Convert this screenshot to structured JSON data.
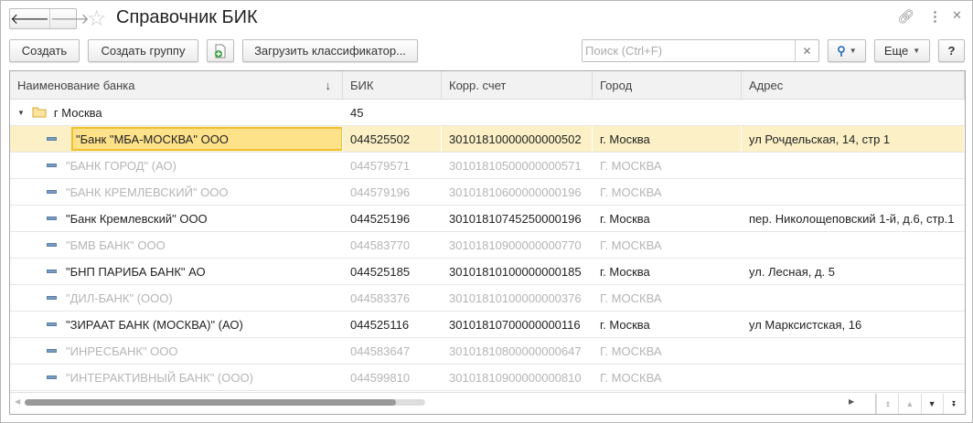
{
  "window": {
    "title": "Справочник БИК"
  },
  "toolbar": {
    "create": "Создать",
    "create_group": "Создать группу",
    "load": "Загрузить классификатор...",
    "search_placeholder": "Поиск (Ctrl+F)",
    "more": "Еще",
    "help": "?"
  },
  "columns": [
    "Наименование банка",
    "БИК",
    "Корр. счет",
    "Город",
    "Адрес"
  ],
  "sort_indicator": "↓",
  "group": {
    "name": "г Москва",
    "count": "45"
  },
  "rows": [
    {
      "name": "\"Банк \"МБА-МОСКВА\" ООО",
      "bik": "044525502",
      "corr": "30101810000000000502",
      "city": "г. Москва",
      "address": "ул Рочдельская, 14, стр 1",
      "state": "selected"
    },
    {
      "name": "\"БАНК ГОРОД\" (АО)",
      "bik": "044579571",
      "corr": "30101810500000000571",
      "city": "Г. МОСКВА",
      "address": "",
      "state": "inactive"
    },
    {
      "name": "\"БАНК КРЕМЛЕВСКИЙ\" ООО",
      "bik": "044579196",
      "corr": "30101810600000000196",
      "city": "Г. МОСКВА",
      "address": "",
      "state": "inactive"
    },
    {
      "name": "\"Банк Кремлевский\" ООО",
      "bik": "044525196",
      "corr": "30101810745250000196",
      "city": "г. Москва",
      "address": "пер. Николощеповский 1-й, д.6, стр.1",
      "state": "active"
    },
    {
      "name": "\"БМВ БАНК\" ООО",
      "bik": "044583770",
      "corr": "30101810900000000770",
      "city": "Г. МОСКВА",
      "address": "",
      "state": "inactive"
    },
    {
      "name": "\"БНП ПАРИБА БАНК\" АО",
      "bik": "044525185",
      "corr": "30101810100000000185",
      "city": "г. Москва",
      "address": "ул. Лесная, д. 5",
      "state": "active"
    },
    {
      "name": "\"ДИЛ-БАНК\" (ООО)",
      "bik": "044583376",
      "corr": "30101810100000000376",
      "city": "Г. МОСКВА",
      "address": "",
      "state": "inactive"
    },
    {
      "name": "\"ЗИРААТ БАНК (МОСКВА)\" (АО)",
      "bik": "044525116",
      "corr": "30101810700000000116",
      "city": "г. Москва",
      "address": "ул Марксистская, 16",
      "state": "active"
    },
    {
      "name": "\"ИНРЕСБАНК\" ООО",
      "bik": "044583647",
      "corr": "30101810800000000647",
      "city": "Г. МОСКВА",
      "address": "",
      "state": "inactive"
    },
    {
      "name": "\"ИНТЕРАКТИВНЫЙ БАНК\" (ООО)",
      "bik": "044599810",
      "corr": "30101810900000000810",
      "city": "Г. МОСКВА",
      "address": "",
      "state": "inactive"
    }
  ],
  "scroll": {
    "horizontal_position_percent": 0
  }
}
